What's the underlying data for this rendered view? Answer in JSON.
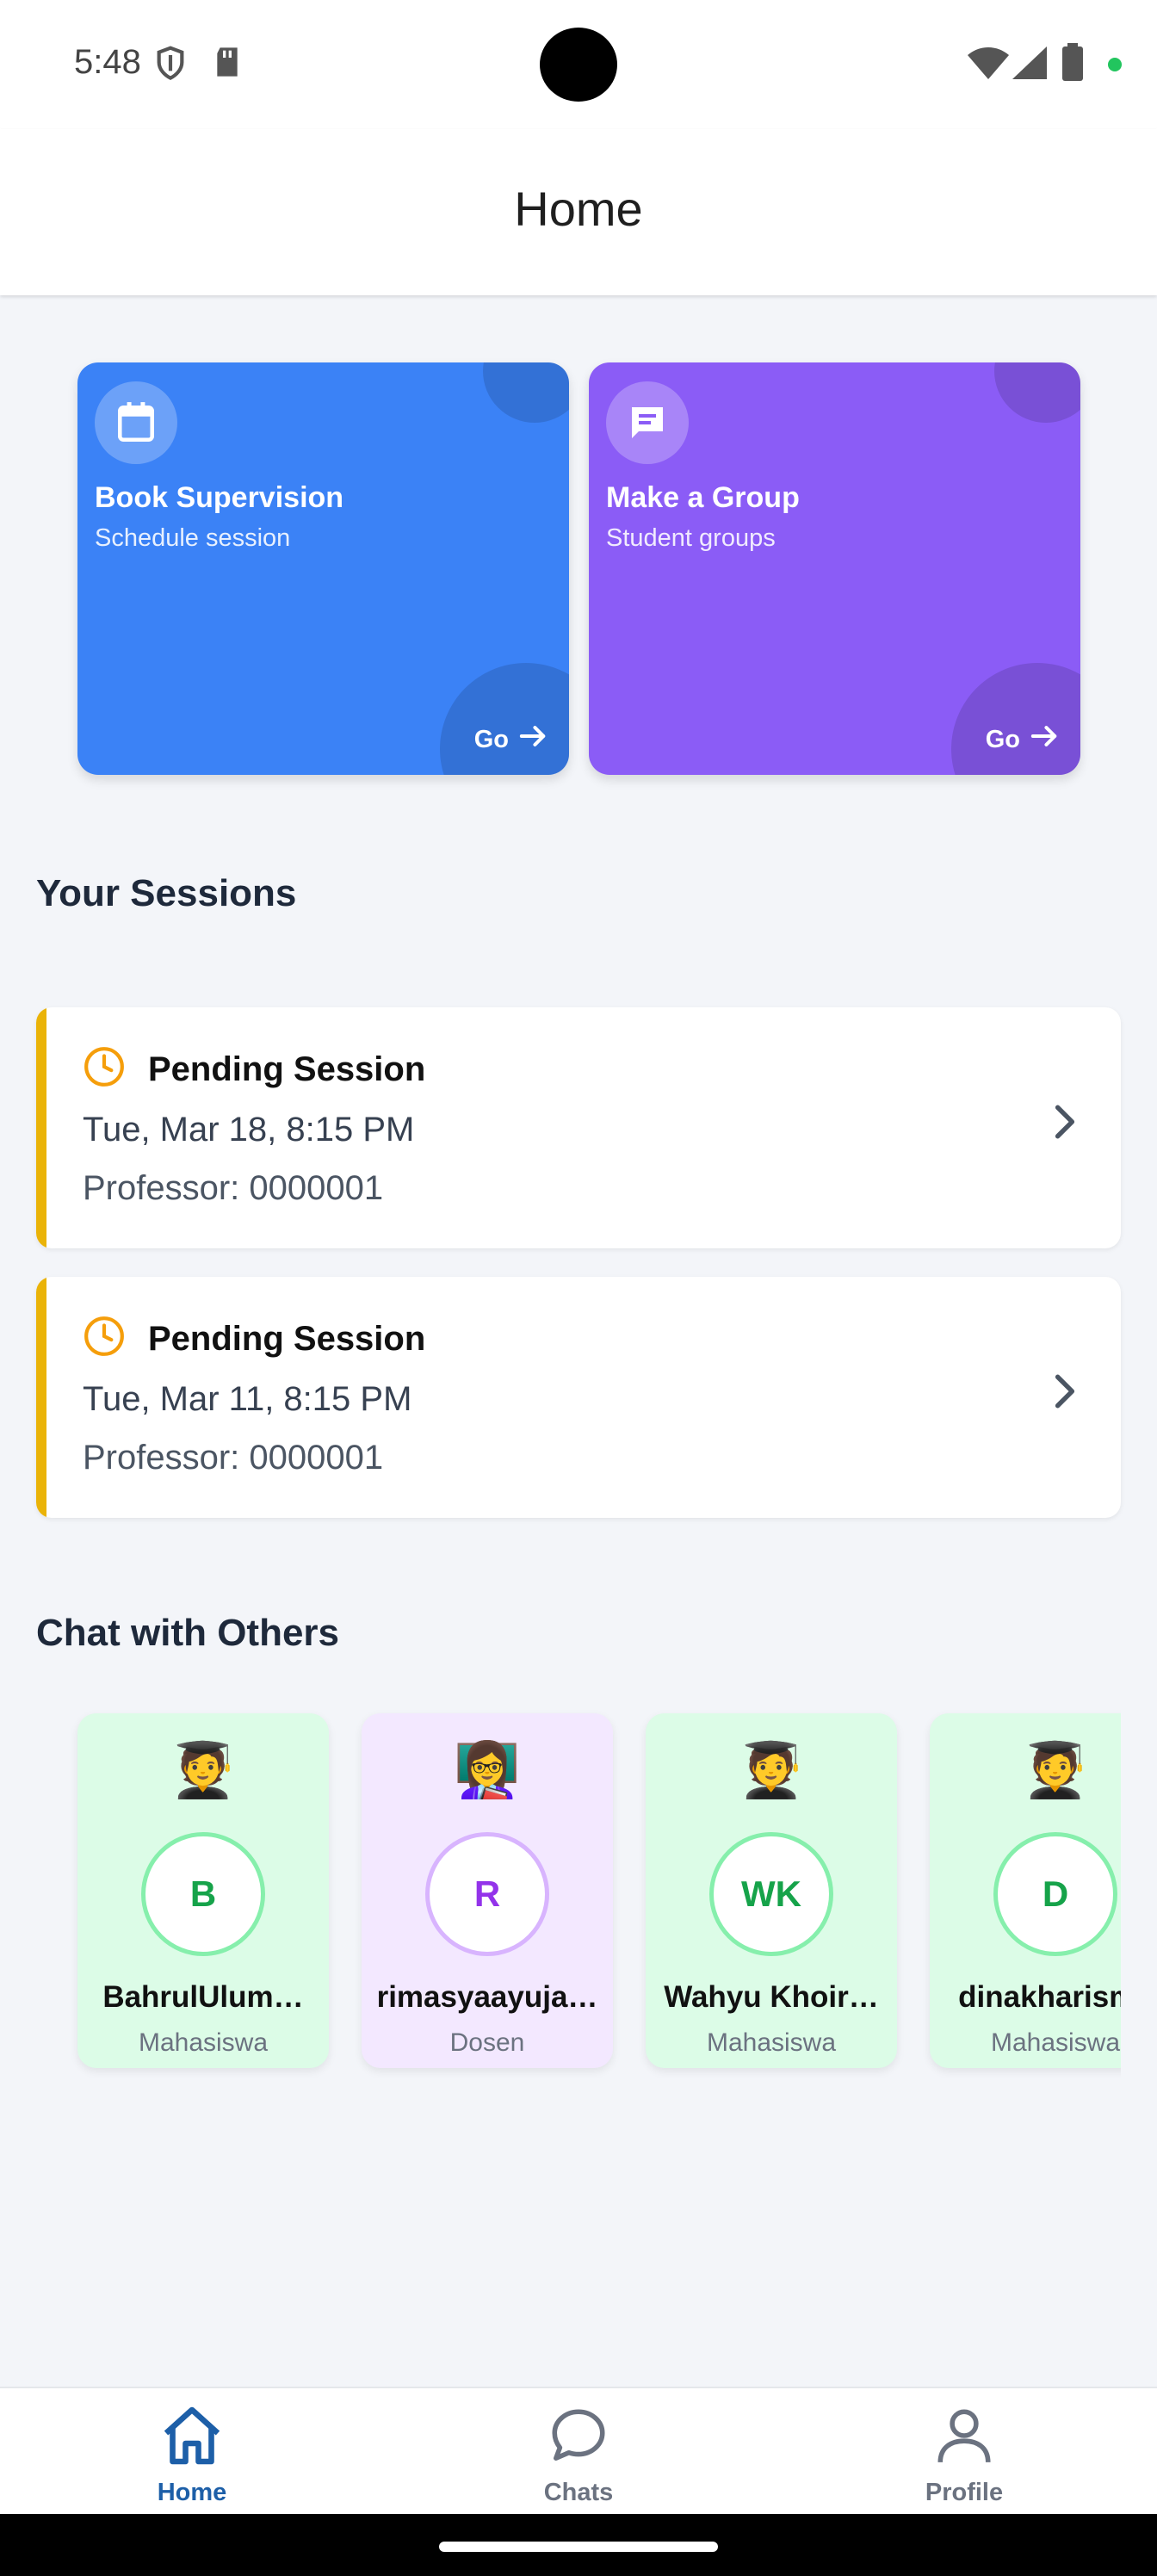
{
  "status_bar": {
    "time": "5:48",
    "icons": [
      "shield-icon",
      "sd-card-icon",
      "wifi-icon",
      "signal-icon",
      "battery-icon"
    ],
    "privacy_dot_color": "#22c55e"
  },
  "app_bar": {
    "title": "Home"
  },
  "actions": [
    {
      "title": "Book Supervision",
      "subtitle": "Schedule session",
      "go": "Go",
      "icon": "calendar-icon",
      "color": "#3b82f6"
    },
    {
      "title": "Make a Group",
      "subtitle": "Student groups",
      "go": "Go",
      "icon": "chat-bubble-icon",
      "color": "#8b5cf6"
    }
  ],
  "sessions_section": {
    "title": "Your Sessions"
  },
  "sessions": [
    {
      "status": "Pending Session",
      "date": "Tue, Mar 18, 8:15 PM",
      "professor": "Professor: 0000001",
      "accent": "#eab308"
    },
    {
      "status": "Pending Session",
      "date": "Tue, Mar 11, 8:15 PM",
      "professor": "Professor: 0000001",
      "accent": "#eab308"
    }
  ],
  "chat_section": {
    "title": "Chat with Others"
  },
  "contacts": [
    {
      "emoji": "🧑‍🎓",
      "initials": "B",
      "name": "BahrulUlum…",
      "role": "Mahasiswa",
      "theme": "green"
    },
    {
      "emoji": "👩‍🏫",
      "initials": "R",
      "name": "rimasyaayuja…",
      "role": "Dosen",
      "theme": "purple"
    },
    {
      "emoji": "🧑‍🎓",
      "initials": "WK",
      "name": "Wahyu Khoir…",
      "role": "Mahasiswa",
      "theme": "green"
    },
    {
      "emoji": "🧑‍🎓",
      "initials": "D",
      "name": "dinakharisma",
      "role": "Mahasiswa",
      "theme": "green"
    }
  ],
  "bottom_nav": [
    {
      "label": "Home",
      "icon": "home-icon",
      "active": true
    },
    {
      "label": "Chats",
      "icon": "chat-icon",
      "active": false
    },
    {
      "label": "Profile",
      "icon": "person-icon",
      "active": false
    }
  ]
}
